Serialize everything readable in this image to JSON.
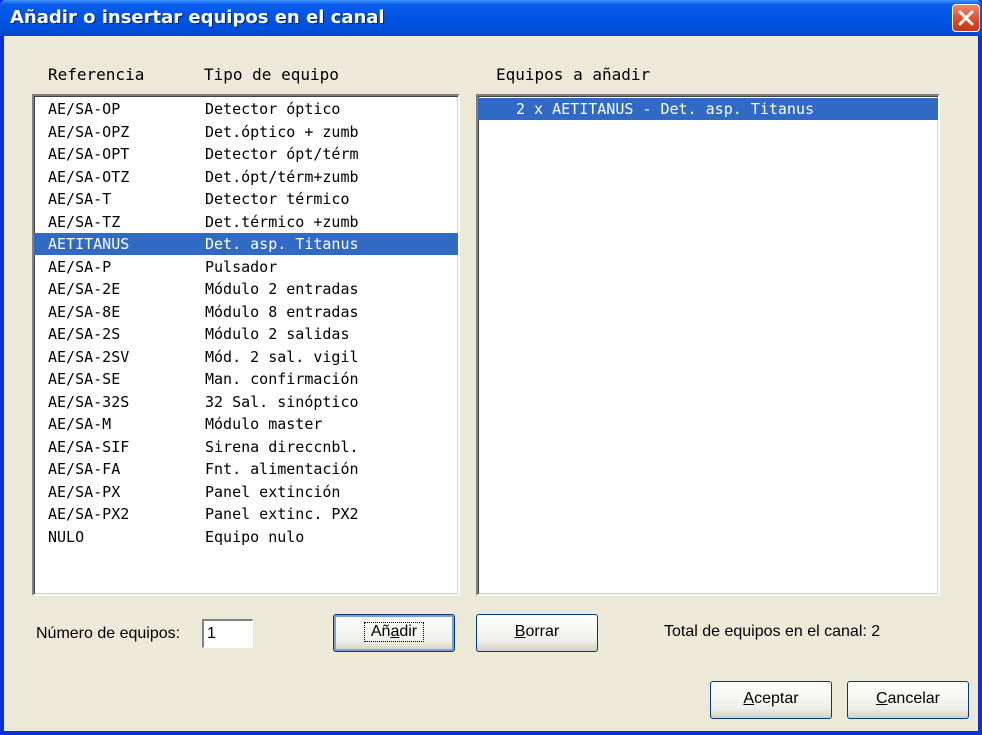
{
  "window": {
    "title": "Añadir o insertar equipos en el canal",
    "close_icon": "close-icon"
  },
  "left_list": {
    "header_ref": "Referencia",
    "header_tipo": "Tipo de equipo",
    "selected_index": 6,
    "items": [
      {
        "ref": "AE/SA-OP",
        "tipo": "Detector óptico"
      },
      {
        "ref": "AE/SA-OPZ",
        "tipo": "Det.óptico + zumb"
      },
      {
        "ref": "AE/SA-OPT",
        "tipo": "Detector ópt/térm"
      },
      {
        "ref": "AE/SA-OTZ",
        "tipo": "Det.ópt/térm+zumb"
      },
      {
        "ref": "AE/SA-T",
        "tipo": "Detector térmico"
      },
      {
        "ref": "AE/SA-TZ",
        "tipo": "Det.térmico +zumb"
      },
      {
        "ref": "AETITANUS",
        "tipo": "Det. asp. Titanus"
      },
      {
        "ref": "AE/SA-P",
        "tipo": "Pulsador"
      },
      {
        "ref": "AE/SA-2E",
        "tipo": "Módulo 2 entradas"
      },
      {
        "ref": "AE/SA-8E",
        "tipo": "Módulo 8 entradas"
      },
      {
        "ref": "AE/SA-2S",
        "tipo": "Módulo 2 salidas"
      },
      {
        "ref": "AE/SA-2SV",
        "tipo": "Mód. 2 sal. vigil"
      },
      {
        "ref": "AE/SA-SE",
        "tipo": "Man. confirmación"
      },
      {
        "ref": "AE/SA-32S",
        "tipo": "32 Sal. sinóptico"
      },
      {
        "ref": "AE/SA-M",
        "tipo": "Módulo master"
      },
      {
        "ref": "AE/SA-SIF",
        "tipo": "Sirena direccnbl."
      },
      {
        "ref": "AE/SA-FA",
        "tipo": "Fnt. alimentación"
      },
      {
        "ref": "AE/SA-PX",
        "tipo": "Panel extinción"
      },
      {
        "ref": "AE/SA-PX2",
        "tipo": "Panel extinc. PX2"
      },
      {
        "ref": "NULO",
        "tipo": "Equipo nulo"
      }
    ]
  },
  "right_list": {
    "header": "Equipos a añadir",
    "items": [
      "2 x AETITANUS - Det. asp. Titanus"
    ]
  },
  "controls": {
    "num_label": "Número de equipos:",
    "num_value": "1",
    "anadir_pre": "Añ",
    "anadir_key": "a",
    "anadir_post": "dir",
    "borrar_key": "B",
    "borrar_post": "orrar",
    "total_label": "Total de equipos en el canal: 2",
    "aceptar_key": "A",
    "aceptar_post": "ceptar",
    "cancelar_key": "C",
    "cancelar_post": "ancelar"
  },
  "colors": {
    "selection": "#316ac5",
    "titlebar": "#0054e3",
    "face": "#ece9d8"
  }
}
